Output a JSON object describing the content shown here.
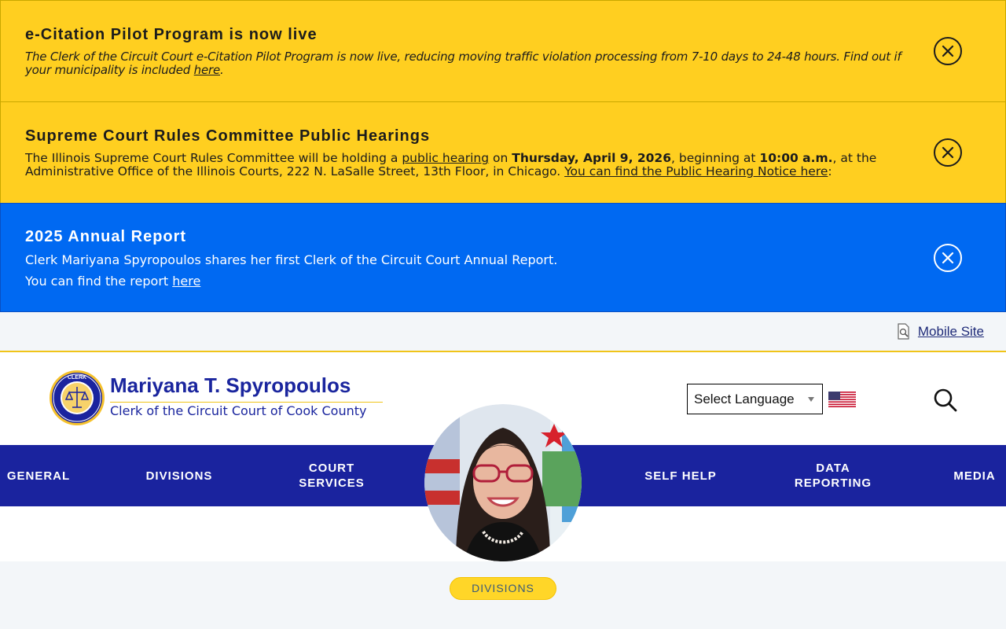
{
  "alerts": [
    {
      "title": "e-Citation Pilot Program is now live",
      "body_pre": "The Clerk of the Circuit Court e-Citation Pilot Program is now live, reducing moving traffic violation processing from 7-10 days to 24-48 hours. Find out if your municipality is included ",
      "link": "here",
      "body_post": "."
    },
    {
      "title": "Supreme Court Rules Committee Public Hearings",
      "body_1": "The Illinois Supreme Court Rules Committee will be holding a ",
      "link_1": "public hearing",
      "body_2": " on ",
      "bold_1": "Thursday, April 9, 2026",
      "body_3": ", beginning at ",
      "bold_2": "10:00 a.m.",
      "body_4": ", at the Administrative Office of the Illinois Courts, 222 N. LaSalle Street, 13th Floor, in Chicago. ",
      "link_2": "You can find the Public Hearing Notice here",
      "body_5": ":"
    },
    {
      "title": "2025 Annual Report",
      "line_1": "Clerk Mariyana Spyropoulos shares her first Clerk of the Circuit Court Annual Report.",
      "line_2_pre": "You can find the report ",
      "link": "here"
    }
  ],
  "utility": {
    "mobile_site_label": "Mobile Site"
  },
  "header": {
    "name": "Mariyana T. Spyropoulos",
    "subtitle": "Clerk of the Circuit Court of Cook County",
    "seal_top_text": "CLERK",
    "language_select": "Select Language"
  },
  "nav": {
    "items": [
      {
        "label": "GENERAL"
      },
      {
        "label": "DIVISIONS"
      },
      {
        "label": "COURT SERVICES"
      },
      {
        "label": "SELF HELP"
      },
      {
        "label": "DATA REPORTING"
      },
      {
        "label": "MEDIA"
      }
    ]
  },
  "breadcrumb_pill": {
    "label": "DIVISIONS"
  },
  "colors": {
    "alert_yellow": "#ffcf20",
    "alert_blue": "#0069f2",
    "brand_navy": "#1a239e",
    "accent_gold": "#f0c419"
  }
}
